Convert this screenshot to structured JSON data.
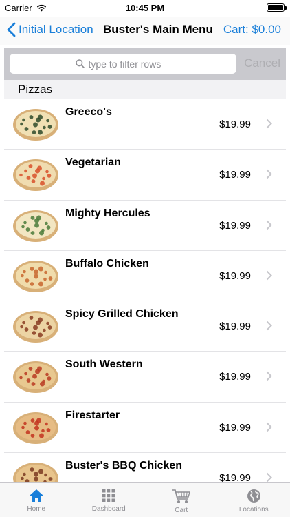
{
  "status_bar": {
    "carrier": "Carrier",
    "time": "10:45 PM"
  },
  "nav": {
    "back_label": "Initial Location",
    "title": "Buster's Main Menu",
    "cart_label": "Cart: $0.00"
  },
  "search": {
    "placeholder": "type to filter rows",
    "cancel_label": "Cancel"
  },
  "section": {
    "title": "Pizzas"
  },
  "items": [
    {
      "name": "Greeco's",
      "price": "$19.99",
      "topping": "#2e4a2a"
    },
    {
      "name": "Vegetarian",
      "price": "$19.99",
      "topping": "#d8502a"
    },
    {
      "name": "Mighty Hercules",
      "price": "$19.99",
      "topping": "#4a7a3a"
    },
    {
      "name": "Buffalo Chicken",
      "price": "$19.99",
      "topping": "#c8662e"
    },
    {
      "name": "Spicy Grilled Chicken",
      "price": "$19.99",
      "topping": "#8a3c22"
    },
    {
      "name": "South Western",
      "price": "$19.99",
      "topping": "#b83a22"
    },
    {
      "name": "Firestarter",
      "price": "$19.99",
      "topping": "#c2341f"
    },
    {
      "name": "Buster's BBQ Chicken",
      "price": "$19.99",
      "topping": "#7a3a20"
    }
  ],
  "tabs": [
    {
      "label": "Home",
      "icon": "home-icon",
      "active": true
    },
    {
      "label": "Dashboard",
      "icon": "grid-icon",
      "active": false
    },
    {
      "label": "Cart",
      "icon": "cart-icon",
      "active": false
    },
    {
      "label": "Locations",
      "icon": "globe-icon",
      "active": false
    }
  ],
  "colors": {
    "accent": "#1a7fd9",
    "inactive": "#8e8e93",
    "search_bg": "#c9c9ce",
    "section_bg": "#f2f2f4"
  }
}
